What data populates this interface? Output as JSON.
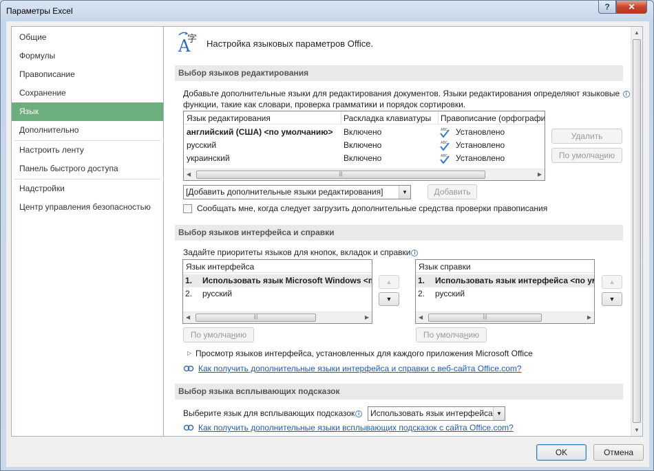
{
  "window": {
    "title": "Параметры Excel",
    "help_label": "?",
    "close_label": "✕"
  },
  "nav": {
    "items": [
      {
        "label": "Общие"
      },
      {
        "label": "Формулы"
      },
      {
        "label": "Правописание"
      },
      {
        "label": "Сохранение"
      },
      {
        "label": "Язык",
        "selected": true
      },
      {
        "label": "Дополнительно"
      },
      {
        "label": "Настроить ленту"
      },
      {
        "label": "Панель быстрого доступа"
      },
      {
        "label": "Надстройки"
      },
      {
        "label": "Центр управления безопасностью"
      }
    ]
  },
  "header": {
    "icon": "language-settings-icon",
    "title": "Настройка языковых параметров Office."
  },
  "editing": {
    "section_title": "Выбор языков редактирования",
    "description_line1": "Добавьте дополнительные языки для редактирования документов. Языки редактирования определяют языковые",
    "description_line2": "функции, такие как словари, проверка грамматики и порядок сортировки.",
    "columns": [
      "Язык редактирования",
      "Раскладка клавиатуры",
      "Правописание (орфографи"
    ],
    "rows": [
      {
        "language": "английский (США) <по умолчанию>",
        "keyboard": "Включено",
        "proofing": "Установлено",
        "bold": true
      },
      {
        "language": "русский",
        "keyboard": "Включено",
        "proofing": "Установлено"
      },
      {
        "language": "украинский",
        "keyboard": "Включено",
        "proofing": "Установлено"
      }
    ],
    "proofing_icon_text": "ABC",
    "remove_label": "Удалить",
    "set_default_prefix": "По умолча",
    "set_default_mnemonic": "н",
    "set_default_suffix": "ию",
    "add_combo_value": "[Добавить дополнительные языки редактирования]",
    "add_label": "Добавить",
    "notify_checkbox_label": "Сообщать мне, когда следует загрузить дополнительные средства проверки правописания",
    "notify_checked": false
  },
  "ui_lang": {
    "section_title": "Выбор языков интерфейса и справки",
    "description": "Задайте приоритеты языков для кнопок, вкладок и справки",
    "display": {
      "header": "Язык интерфейса",
      "items": [
        {
          "num": "1.",
          "label": "Использовать язык Microsoft Windows <п",
          "bold": true
        },
        {
          "num": "2.",
          "label": "русский"
        }
      ],
      "default_prefix": "По умолча",
      "default_mnemonic": "н",
      "default_suffix": "ию"
    },
    "help": {
      "header": "Язык справки",
      "items": [
        {
          "num": "1.",
          "label": "Использовать язык интерфейса <по ум",
          "bold": true
        },
        {
          "num": "2.",
          "label": "русский"
        }
      ],
      "default_prefix": "По умолча",
      "default_mnemonic": "н",
      "default_suffix": "ию"
    },
    "expander_label": "Просмотр языков интерфейса, установленных для каждого приложения Microsoft Office",
    "link_label": "Как получить дополнительные языки интерфейса и справки с веб-сайта Office.com?"
  },
  "screentip": {
    "section_title": "Выбор языка всплывающих подсказок",
    "label": "Выберите язык для всплывающих подсказок",
    "combo_value": "Использовать язык интерфейса",
    "link_label": "Как получить дополнительные языки всплывающих подсказок с сайта Office.com?"
  },
  "footer": {
    "ok_label": "OK",
    "cancel_label": "Отмена"
  },
  "colors": {
    "nav_selected": "#6dae7e",
    "link": "#1e5bb5",
    "section_bar": "#e9e9e9"
  }
}
